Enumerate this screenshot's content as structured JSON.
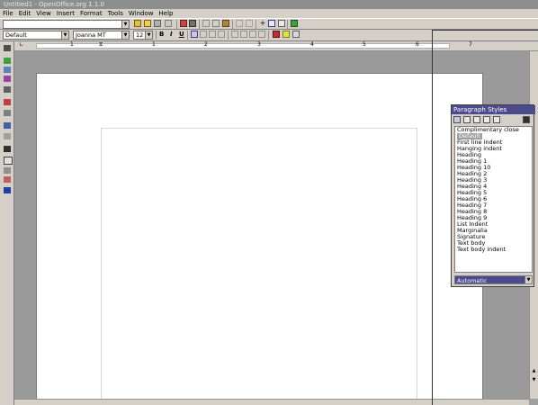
{
  "window": {
    "title": "Untitled1 - OpenOffice.org 1.1.0"
  },
  "menu": [
    "File",
    "Edit",
    "View",
    "Insert",
    "Format",
    "Tools",
    "Window",
    "Help"
  ],
  "format_bar": {
    "paragraph_style": "Default",
    "font_name": "Joanna MT",
    "font_size": "12",
    "bold": "B",
    "italic": "I",
    "underline": "U"
  },
  "ruler": {
    "numbers": [
      "1",
      "1",
      "2",
      "3",
      "4",
      "5",
      "6",
      "7"
    ]
  },
  "stylist": {
    "title": "Paragraph Styles",
    "items": [
      "Complimentary close",
      "Default",
      "First line indent",
      "Hanging indent",
      "Heading",
      "Heading 1",
      "Heading 10",
      "Heading 2",
      "Heading 3",
      "Heading 4",
      "Heading 5",
      "Heading 6",
      "Heading 7",
      "Heading 8",
      "Heading 9",
      "List Indent",
      "Marginalia",
      "Signature",
      "Text body",
      "Text body indent"
    ],
    "selected_item": "Default",
    "filter": "Automatic"
  },
  "colors": {
    "accent": "#4a4a8c",
    "chrome": "#d4d0c8"
  }
}
